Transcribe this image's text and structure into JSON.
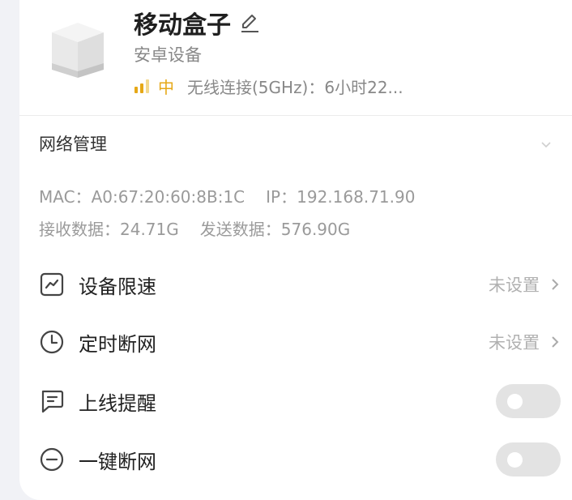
{
  "device": {
    "name": "移动盒子",
    "type": "安卓设备",
    "signal_level": "中",
    "connection": "无线连接(5GHz)：6小时22..."
  },
  "network": {
    "title": "网络管理",
    "mac_label": "MAC：",
    "mac_value": "A0:67:20:60:8B:1C",
    "ip_label": "IP：",
    "ip_value": "192.168.71.90",
    "rx_label": "接收数据：",
    "rx_value": "24.71G",
    "tx_label": "发送数据：",
    "tx_value": "576.90G"
  },
  "settings": {
    "speed_limit": {
      "label": "设备限速",
      "value": "未设置"
    },
    "timed_disconnect": {
      "label": "定时断网",
      "value": "未设置"
    },
    "online_reminder": {
      "label": "上线提醒",
      "enabled": false
    },
    "one_click_disconnect": {
      "label": "一键断网",
      "enabled": false
    }
  },
  "colors": {
    "signal": "#e6a817",
    "muted": "#9a9a9a",
    "toggle_off": "#e3e3e3"
  }
}
